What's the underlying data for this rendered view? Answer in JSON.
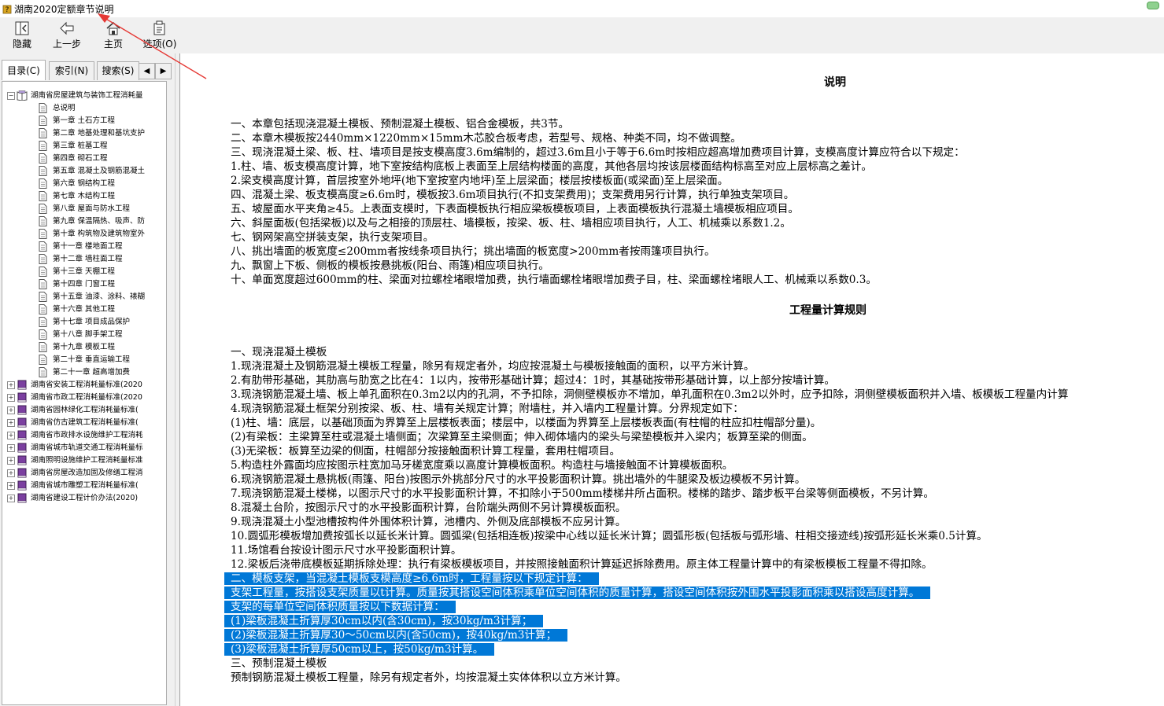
{
  "window": {
    "title": "湖南2020定额章节说明"
  },
  "toolbar": {
    "hide_label": "隐藏",
    "back_label": "上一步",
    "home_label": "主页",
    "options_label": "选项(O)"
  },
  "tabs": {
    "contents": "目录(C)",
    "index": "索引(N)",
    "search": "搜索(S)",
    "arrow_left": "◀",
    "arrow_right": "▶"
  },
  "tree": {
    "root": "湖南省房屋建筑与装饰工程消耗量",
    "children": [
      "总说明",
      "第一章 土石方工程",
      "第二章 地基处理和基坑支护",
      "第三章 桩基工程",
      "第四章 砌石工程",
      "第五章 混凝土及钢筋混凝土",
      "第六章 钢结构工程",
      "第七章 木结构工程",
      "第八章 屋面与防水工程",
      "第九章 保温隔热、吸声、防",
      "第十章 构筑物及建筑物室外",
      "第十一章 楼地面工程",
      "第十二章 墙柱面工程",
      "第十三章 天棚工程",
      "第十四章 门窗工程",
      "第十五章 油漆、涂料、裱糊",
      "第十六章 其他工程",
      "第十七章 项目成品保护",
      "第十八章 脚手架工程",
      "第十九章 模板工程",
      "第二十章 垂直运输工程",
      "第二十一章 超高增加费"
    ],
    "books": [
      "湖南省安装工程消耗量标准(2020",
      "湖南省市政工程消耗量标准(2020",
      "湖南省园林绿化工程消耗量标准(",
      "湖南省仿古建筑工程消耗量标准(",
      "湖南省市政排水设施维护工程消耗",
      "湖南省城市轨道交通工程消耗量标",
      "湖南照明设施维护工程消耗量标准",
      "湖南省房屋改造加固及修缮工程消",
      "湖南省城市雕塑工程消耗量标准(",
      "湖南省建设工程计价办法(2020)"
    ]
  },
  "content": {
    "heading1": "说明",
    "section1": [
      "一、本章包括现浇混凝土模板、预制混凝土模板、铝合金模板，共3节。",
      "二、本章木模板按2440mm×1220mm×15mm木芯胶合板考虑，若型号、规格、种类不同，均不做调整。",
      "三、现浇混凝土梁、板、柱、墙项目是按支模高度3.6m编制的，超过3.6m且小于等于6.6m时按相应超高增加费项目计算，支模高度计算应符合以下规定：",
      "1.柱、墙、板支模高度计算，地下室按结构底板上表面至上层结构楼面的高度，其他各层均按该层楼面结构标高至对应上层标高之差计。",
      "2.梁支模高度计算，首层按室外地坪(地下室按室内地坪)至上层梁面；楼层按楼板面(或梁面)至上层梁面。",
      "四、混凝土梁、板支模高度≥6.6m时，模板按3.6m项目执行(不扣支架费用)；支架费用另行计算，执行单独支架项目。",
      "五、坡屋面水平夹角≥45。上表面支模时，下表面模板执行相应梁板模板项目，上表面模板执行混凝土墙模板相应项目。",
      "六、斜屋面板(包括梁板)以及与之相接的顶层柱、墙模板，按梁、板、柱、墙相应项目执行，人工、机械乘以系数1.2。",
      "七、钢网架高空拼装支架，执行支架项目。",
      "八、挑出墙面的板宽度≤200mm者按线条项目执行；挑出墙面的板宽度>200mm者按雨篷项目执行。",
      "九、飘窗上下板、侧板的模板按悬挑板(阳台、雨篷)相应项目执行。",
      "十、单面宽度超过600mm的柱、梁面对拉螺栓堵眼增加费，执行墙面螺栓堵眼增加费子目，柱、梁面螺栓堵眼人工、机械乘以系数0.3。"
    ],
    "heading2": "工程量计算规则",
    "section2": [
      "一、现浇混凝土模板",
      "1.现浇混凝土及钢筋混凝土模板工程量，除另有规定者外，均应按混凝土与模板接触面的面积，以平方米计算。",
      "2.有肋带形基础，其肋高与肋宽之比在4：1以内，按带形基础计算；超过4：1时，其基础按带形基础计算，以上部分按墙计算。",
      "3.现浇钢筋混凝土墙、板上单孔面积在0.3m2以内的孔洞，不予扣除，洞侧壁模板亦不增加，单孔面积在0.3m2以外时，应予扣除，洞侧壁模板面积并入墙、板模板工程量内计算",
      "4.现浇钢筋混凝土框架分别按梁、板、柱、墙有关规定计算；附墙柱，并入墙内工程量计算。分界规定如下：",
      "(1)柱、墙：底层，以基础顶面为界算至上层楼板表面；楼层中，以楼面为界算至上层楼板表面(有柱帽的柱应扣柱帽部分量)。",
      "(2)有梁板：主梁算至柱或混凝土墙侧面；次梁算至主梁侧面；伸入砌体墙内的梁头与梁垫模板并入梁内；板算至梁的侧面。",
      "(3)无梁板：板算至边梁的侧面，柱帽部分按接触面积计算工程量，套用柱帽项目。",
      "5.构造柱外露面均应按图示柱宽加马牙槎宽度乘以高度计算模板面积。构造柱与墙接触面不计算模板面积。",
      "6.现浇钢筋混凝土悬挑板(雨篷、阳台)按图示外挑部分尺寸的水平投影面积计算。挑出墙外的牛腿梁及板边模板不另计算。",
      "7.现浇钢筋混凝土楼梯，以图示尺寸的水平投影面积计算，不扣除小于500mm楼梯井所占面积。楼梯的踏步、踏步板平台梁等侧面模板，不另计算。",
      "8.混凝土台阶，按图示尺寸的水平投影面积计算，台阶端头两侧不另计算模板面积。",
      "9.现浇混凝土小型池槽按构件外围体积计算，池槽内、外侧及底部模板不应另计算。",
      "10.圆弧形模板增加费按弧长以延长米计算。圆弧梁(包括相连板)按梁中心线以延长米计算；圆弧形板(包括板与弧形墙、柱相交接迹线)按弧形延长米乘0.5计算。",
      "11.场馆看台按设计图示尺寸水平投影面积计算。",
      "12.梁板后浇带底模板延期拆除处理：执行有梁板模板项目，并按照接触面积计算延迟拆除费用。原主体工程量计算中的有梁板模板工程量不得扣除。"
    ],
    "highlighted": [
      "二、模板支架，当混凝土模板支模高度≥6.6m时，工程量按以下规定计算：",
      "支架工程量，按搭设支架质量以t计算。质量按其搭设空间体积乘单位空间体积的质量计算，搭设空间体积按外围水平投影面积乘以搭设高度计算。",
      "支架的每单位空间体积质量按以下数据计算：",
      "(1)梁板混凝土折算厚30cm以内(含30cm)，按30kg/m3计算；",
      "(2)梁板混凝土折算厚30～50cm以内(含50cm)，按40kg/m3计算；",
      "(3)梁板混凝土折算厚50cm以上，按50kg/m3计算。"
    ],
    "section3": [
      "三、预制混凝土模板",
      "预制钢筋混凝土模板工程量，除另有规定者外，均按混凝土实体体积以立方米计算。"
    ]
  },
  "colors": {
    "selection": "#0078d7",
    "annotation_arrow": "#e53935"
  }
}
